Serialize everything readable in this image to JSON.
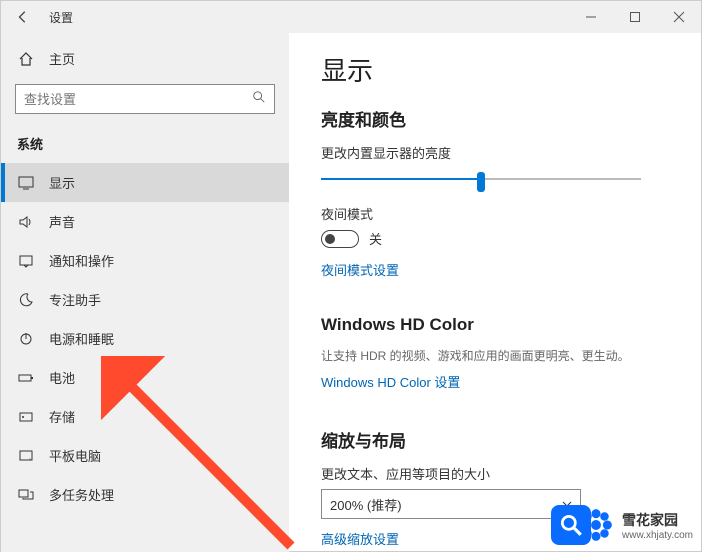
{
  "titlebar": {
    "title": "设置"
  },
  "sidebar": {
    "home": "主页",
    "search_placeholder": "查找设置",
    "group": "系统",
    "items": [
      {
        "label": "显示"
      },
      {
        "label": "声音"
      },
      {
        "label": "通知和操作"
      },
      {
        "label": "专注助手"
      },
      {
        "label": "电源和睡眠"
      },
      {
        "label": "电池"
      },
      {
        "label": "存储"
      },
      {
        "label": "平板电脑"
      },
      {
        "label": "多任务处理"
      }
    ]
  },
  "content": {
    "page_title": "显示",
    "brightness": {
      "heading": "亮度和颜色",
      "label": "更改内置显示器的亮度",
      "value_percent": 50
    },
    "night": {
      "label": "夜间模式",
      "state": "关",
      "link": "夜间模式设置"
    },
    "hd": {
      "heading": "Windows HD Color",
      "desc": "让支持 HDR 的视频、游戏和应用的画面更明亮、更生动。",
      "link": "Windows HD Color 设置"
    },
    "scale": {
      "heading": "缩放与布局",
      "label": "更改文本、应用等项目的大小",
      "value": "200% (推荐)",
      "link": "高级缩放设置"
    }
  },
  "watermarks": {
    "xuehua": {
      "main": "雪花家园",
      "sub": "www.xhjaty.com"
    }
  }
}
